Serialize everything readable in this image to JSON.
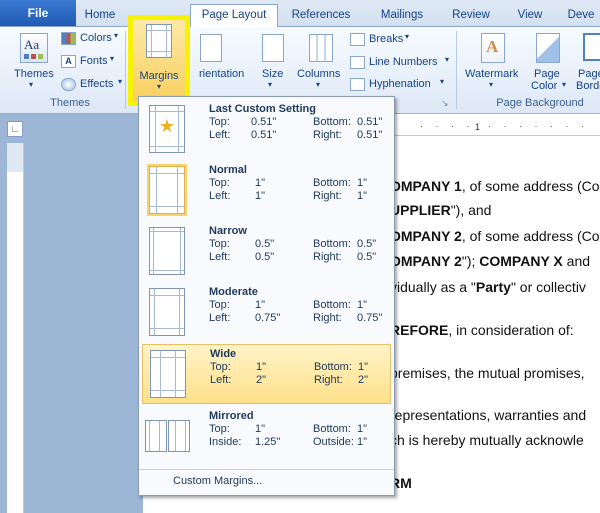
{
  "tabs": {
    "file": "File",
    "home": "Home",
    "active": "Page Layout",
    "references": "References",
    "mailings": "Mailings",
    "review": "Review",
    "view": "View",
    "developer": "Deve"
  },
  "ribbon": {
    "themes": {
      "label": "Themes",
      "colors": "Colors",
      "fonts": "Fonts",
      "effects": "Effects",
      "group": "Themes"
    },
    "margins": "Margins",
    "orientation": "rientation",
    "size": "Size",
    "columns": "Columns",
    "breaks": "Breaks",
    "line_numbers": "Line Numbers",
    "hyphenation": "Hyphenation",
    "watermark": "Watermark",
    "page_color": "Page",
    "page_color2": "Color",
    "page_borders": "Page",
    "page_borders2": "Border",
    "background_group": "Page Background"
  },
  "margins_menu": {
    "items": [
      {
        "name": "Last Custom Setting",
        "k1": "Top:",
        "v1": "0.51\"",
        "k2": "Bottom:",
        "v2": "0.51\"",
        "k3": "Left:",
        "v3": "0.51\"",
        "k4": "Right:",
        "v4": "0.51\""
      },
      {
        "name": "Normal",
        "k1": "Top:",
        "v1": "1\"",
        "k2": "Bottom:",
        "v2": "1\"",
        "k3": "Left:",
        "v3": "1\"",
        "k4": "Right:",
        "v4": "1\""
      },
      {
        "name": "Narrow",
        "k1": "Top:",
        "v1": "0.5\"",
        "k2": "Bottom:",
        "v2": "0.5\"",
        "k3": "Left:",
        "v3": "0.5\"",
        "k4": "Right:",
        "v4": "0.5\""
      },
      {
        "name": "Moderate",
        "k1": "Top:",
        "v1": "1\"",
        "k2": "Bottom:",
        "v2": "1\"",
        "k3": "Left:",
        "v3": "0.75\"",
        "k4": "Right:",
        "v4": "0.75\""
      },
      {
        "name": "Wide",
        "k1": "Top:",
        "v1": "1\"",
        "k2": "Bottom:",
        "v2": "1\"",
        "k3": "Left:",
        "v3": "2\"",
        "k4": "Right:",
        "v4": "2\""
      },
      {
        "name": "Mirrored",
        "k1": "Top:",
        "v1": "1\"",
        "k2": "Bottom:",
        "v2": "1\"",
        "k3": "Inside:",
        "v3": "1.25\"",
        "k4": "Outside:",
        "v4": "1\""
      }
    ],
    "custom": "Custom Margins..."
  },
  "document": {
    "l1a": "OMPANY 1",
    "l1b": ", of some address (Co",
    "l2a": "UPPLIER",
    "l2b": "\"), and",
    "l3a": "OMPANY 2",
    "l3b": ", of some address (Co",
    "l4a": "OMPANY 2",
    "l4b": "\"); ",
    "l4c": "COMPANY X",
    "l4d": " and",
    "l5a": "vidually as a \"",
    "l5b": "Party",
    "l5c": "\" or collectiv",
    "l6a": "REFORE",
    "l6b": ", in consideration of:",
    "l7": "premises, the mutual promises,",
    "l8": "representations, warranties and",
    "l9": "ch is hereby mutually acknowle",
    "l10": "RM"
  }
}
